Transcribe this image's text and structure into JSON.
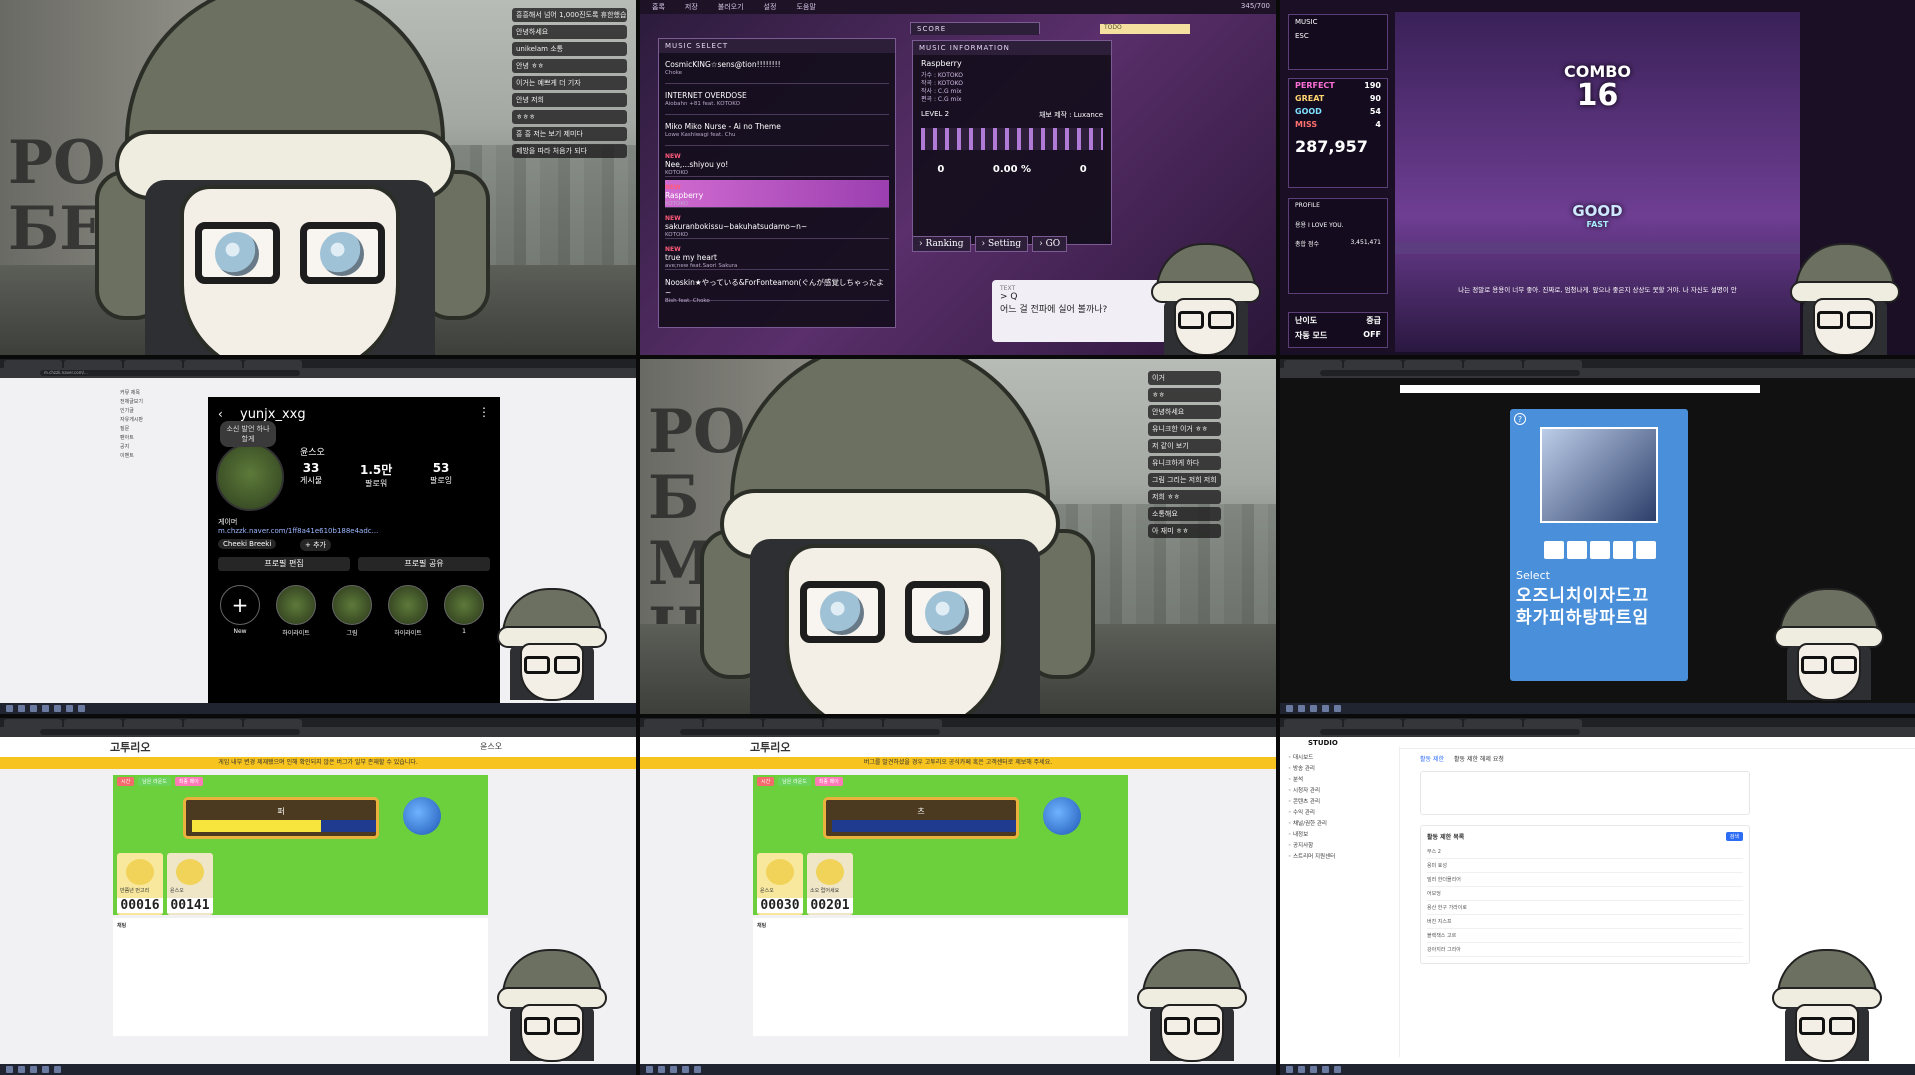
{
  "panel1": {
    "chat": [
      "흥흥해서 넘어 1,000진도록 휴한했습니다.",
      "안녕하세요",
      "unikelam 소통",
      "안녕 ㅎㅎ",
      "이거는 예쁘게 더 기자",
      "안녕 저희",
      "ㅎㅎㅎ",
      "흥 흥 저는 보기 제미다",
      "제방을 따라 처음가 되다"
    ]
  },
  "panel2": {
    "menu": [
      "홈록",
      "저장",
      "불러오기",
      "설정",
      "도움말"
    ],
    "status": "345/700",
    "music_select_title": "MUSIC SELECT",
    "songs": [
      {
        "new": "",
        "title": "CosmicKING☆sens@tion!!!!!!!!",
        "artist": "Choke"
      },
      {
        "new": "",
        "title": "INTERNET OVERDOSE",
        "artist": "Aiobahn +81 feat. KOTOKO"
      },
      {
        "new": "",
        "title": "Miko Miko Nurse - Ai no Theme",
        "artist": "Lowe Kashiwagi feat. Chu"
      },
      {
        "new": "NEW",
        "title": "Nee,...shiyou yo!",
        "artist": "KOTOKO"
      },
      {
        "new": "NEW",
        "title": "Raspberry",
        "artist": "KOTOKO"
      },
      {
        "new": "NEW",
        "title": "sakuranbokissu~bakuhatsudamo~n~",
        "artist": "KOTOKO"
      },
      {
        "new": "NEW",
        "title": "true my heart",
        "artist": "ave;new feat.Saori Sakura"
      },
      {
        "new": "",
        "title": "Nooskin★やっている&ForFonteamon(ぐんが感覚しちゃったよ~",
        "artist": "Bish feat. Choko"
      }
    ],
    "score_label": "SCORE",
    "info_title": "MUSIC INFORMATION",
    "info_song": "Raspberry",
    "info_lines": [
      "가수 : KOTOKO",
      "작곡 : KOTOKO",
      "작사 : C.G mix",
      "편곡 : C.G mix"
    ],
    "level": "LEVEL 2",
    "chart_by": "채보 제작 : Luxance",
    "accuracy": "0.00 %",
    "score_a": "0",
    "score_b": "0",
    "buttons": [
      "Ranking",
      "Setting",
      "GO"
    ],
    "text_label": "TEXT",
    "text_q": "> Q",
    "text_line": "어느 걸 전파에 실어 볼까나?",
    "todo": "TODO"
  },
  "panel3": {
    "title": "MUSIC",
    "esc": "ESC",
    "judge": [
      {
        "label": "PERFECT",
        "value": "190"
      },
      {
        "label": "GREAT",
        "value": "90"
      },
      {
        "label": "GOOD",
        "value": "54"
      },
      {
        "label": "MISS",
        "value": "4"
      }
    ],
    "score": "287,957",
    "combo_label": "COMBO",
    "combo_value": "16",
    "judgement": "GOOD",
    "timing": "FAST",
    "profile": "PROFILE",
    "profile_text": "용용 I LOVE YOU.",
    "total_label": "총합 점수",
    "total": "3,451,471",
    "subtitle": "나는 정말로 용용이 너무 좋아. 진짜로, 엄청나게. 앞으나 좋은지 상상도 못할 거야. 나 자신도 설명이 안",
    "difficulty_label": "난이도",
    "difficulty": "중급",
    "auto_label": "자동 모드",
    "auto": "OFF"
  },
  "panel4": {
    "url": "m.chzzk.naver.com/...",
    "username": "yunjx_xxg",
    "bubble": "소신 발언 하나 할게",
    "display_name": "윤스오",
    "posts": "33",
    "posts_label": "게시물",
    "followers": "1.5만",
    "followers_label": "팔로워",
    "following": "53",
    "following_label": "팔로잉",
    "bio": "게이머",
    "link": "m.chzzk.naver.com/1ff8a41e610b188e4adc...",
    "tag1": "Cheeki Breeki",
    "tag2": "+ 추가",
    "btn_edit": "프로필 편집",
    "btn_share": "프로필 공유",
    "highlights": [
      "New",
      "하이라이트",
      "그림",
      "하이라이트",
      "1"
    ],
    "sidebar": [
      "커뮤 제목",
      "전체글보기",
      "인기글",
      "자유게시판",
      "질문",
      "팬아트",
      "공지",
      "이벤트"
    ]
  },
  "panel5": {
    "chat": [
      "이거",
      "ㅎㅎ",
      "안녕하세요",
      "유니크한 이거 ㅎㅎ",
      "저 같이 보기",
      "유니크하게 하다",
      "그림 그리는 저희 저희",
      "저희 ㅎㅎ",
      "소통해요",
      "아 재미 ㅎㅎ"
    ]
  },
  "panel6": {
    "select": "Select",
    "keyboard_row1": "오즈니치이자드끄",
    "keyboard_row2": "화가피하탕파트임",
    "question": "?"
  },
  "panel7": {
    "logo": "고투리오",
    "user": "윤스오",
    "notice": "게임 내부 변경 제재됐으며 인해 확인되지 않은 버그가 일부 존재할 수 있습니다.",
    "tabs": [
      "시간",
      "남은 라운드",
      "최종 페이"
    ],
    "word": "퍼",
    "players": [
      {
        "name": "반쯤년 먼고리",
        "score": "00016"
      },
      {
        "name": "윤스오",
        "score": "00141"
      }
    ],
    "chat_title": "채팅"
  },
  "panel8": {
    "logo": "고투리오",
    "notice": "버그를 발견하셨을 경우 고투리오 공식카페 혹은 고객센터로 제보해 주세요.",
    "tabs": [
      "시간",
      "남은 라운드",
      "최종 페이"
    ],
    "word": "츠",
    "players": [
      {
        "name": "윤스오",
        "score": "00030"
      },
      {
        "name": "소오 럽어세요",
        "score": "00201"
      }
    ],
    "chat_title": "채팅"
  },
  "panel9": {
    "brand": "STUDIO",
    "tab1": "활동 제한",
    "tab2": "활동 제한 해제 요청",
    "nav": [
      "대시보드",
      "방송 관리",
      "분석",
      "시청자 관리",
      "콘텐츠 관리",
      "수익 관리",
      "채널/권한 관리",
      "내정보",
      "공지사항",
      "스트리머 지원센터"
    ],
    "section": "활동 제한 목록",
    "search_btn": "검색",
    "rows": [
      "부스 2",
      "용미 효성",
      "빌러 한더몰리어",
      "어모엉",
      "용산 한구 가라이로",
      "버진 지스프",
      "블랙잭스 고르",
      "강아지라 그리아"
    ]
  }
}
